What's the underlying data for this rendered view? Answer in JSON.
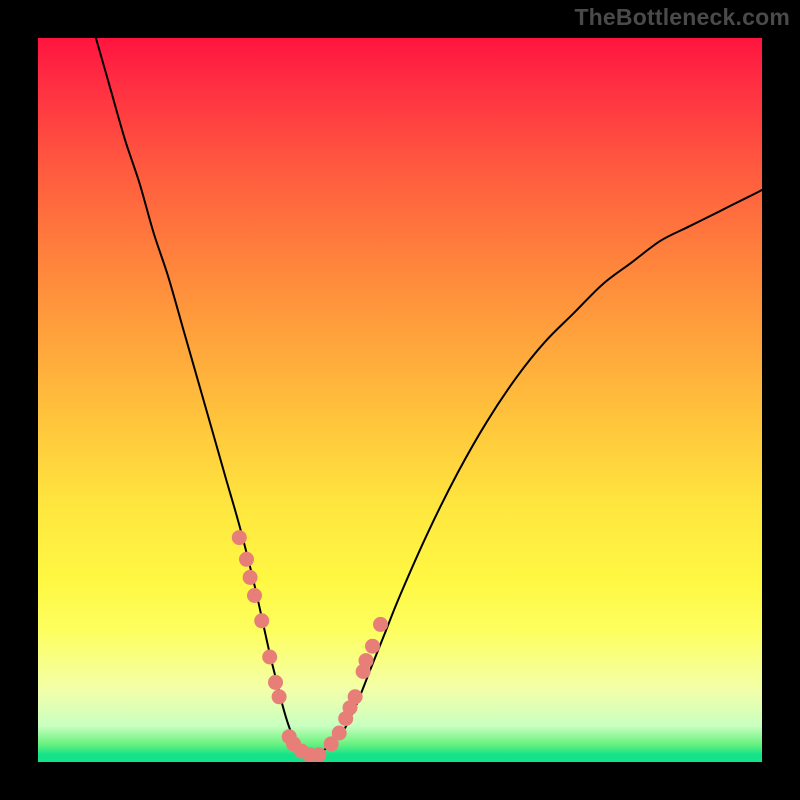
{
  "watermark": "TheBottleneck.com",
  "chart_data": {
    "type": "line",
    "title": "",
    "xlabel": "",
    "ylabel": "",
    "xlim": [
      0,
      100
    ],
    "ylim": [
      0,
      100
    ],
    "grid": false,
    "legend": false,
    "series": [
      {
        "name": "curve",
        "x": [
          8,
          10,
          12,
          14,
          16,
          18,
          20,
          22,
          24,
          26,
          28,
          30,
          32,
          33,
          34,
          35,
          36,
          37,
          38,
          40,
          42,
          44,
          46,
          48,
          50,
          54,
          58,
          62,
          66,
          70,
          74,
          78,
          82,
          86,
          90,
          94,
          98,
          100
        ],
        "y": [
          100,
          93,
          86,
          80,
          73,
          67,
          60,
          53,
          46,
          39,
          32,
          24,
          15,
          11,
          7,
          4,
          2,
          1,
          1,
          2,
          4,
          8,
          13,
          18,
          23,
          32,
          40,
          47,
          53,
          58,
          62,
          66,
          69,
          72,
          74,
          76,
          78,
          79
        ]
      }
    ],
    "markers": {
      "name": "dots",
      "x": [
        27.8,
        28.8,
        29.3,
        29.9,
        30.9,
        32.0,
        32.8,
        33.3,
        34.7,
        35.3,
        36.4,
        37.5,
        38.8,
        40.5,
        41.6,
        42.5,
        43.1,
        43.8,
        44.9,
        45.3,
        46.2,
        47.3
      ],
      "y": [
        31.0,
        28.0,
        25.5,
        23.0,
        19.5,
        14.5,
        11.0,
        9.0,
        3.5,
        2.5,
        1.5,
        1.0,
        1.0,
        2.5,
        4.0,
        6.0,
        7.5,
        9.0,
        12.5,
        14.0,
        16.0,
        19.0
      ]
    },
    "colors": {
      "curve": "#000000",
      "markers": "#e77f78"
    }
  }
}
